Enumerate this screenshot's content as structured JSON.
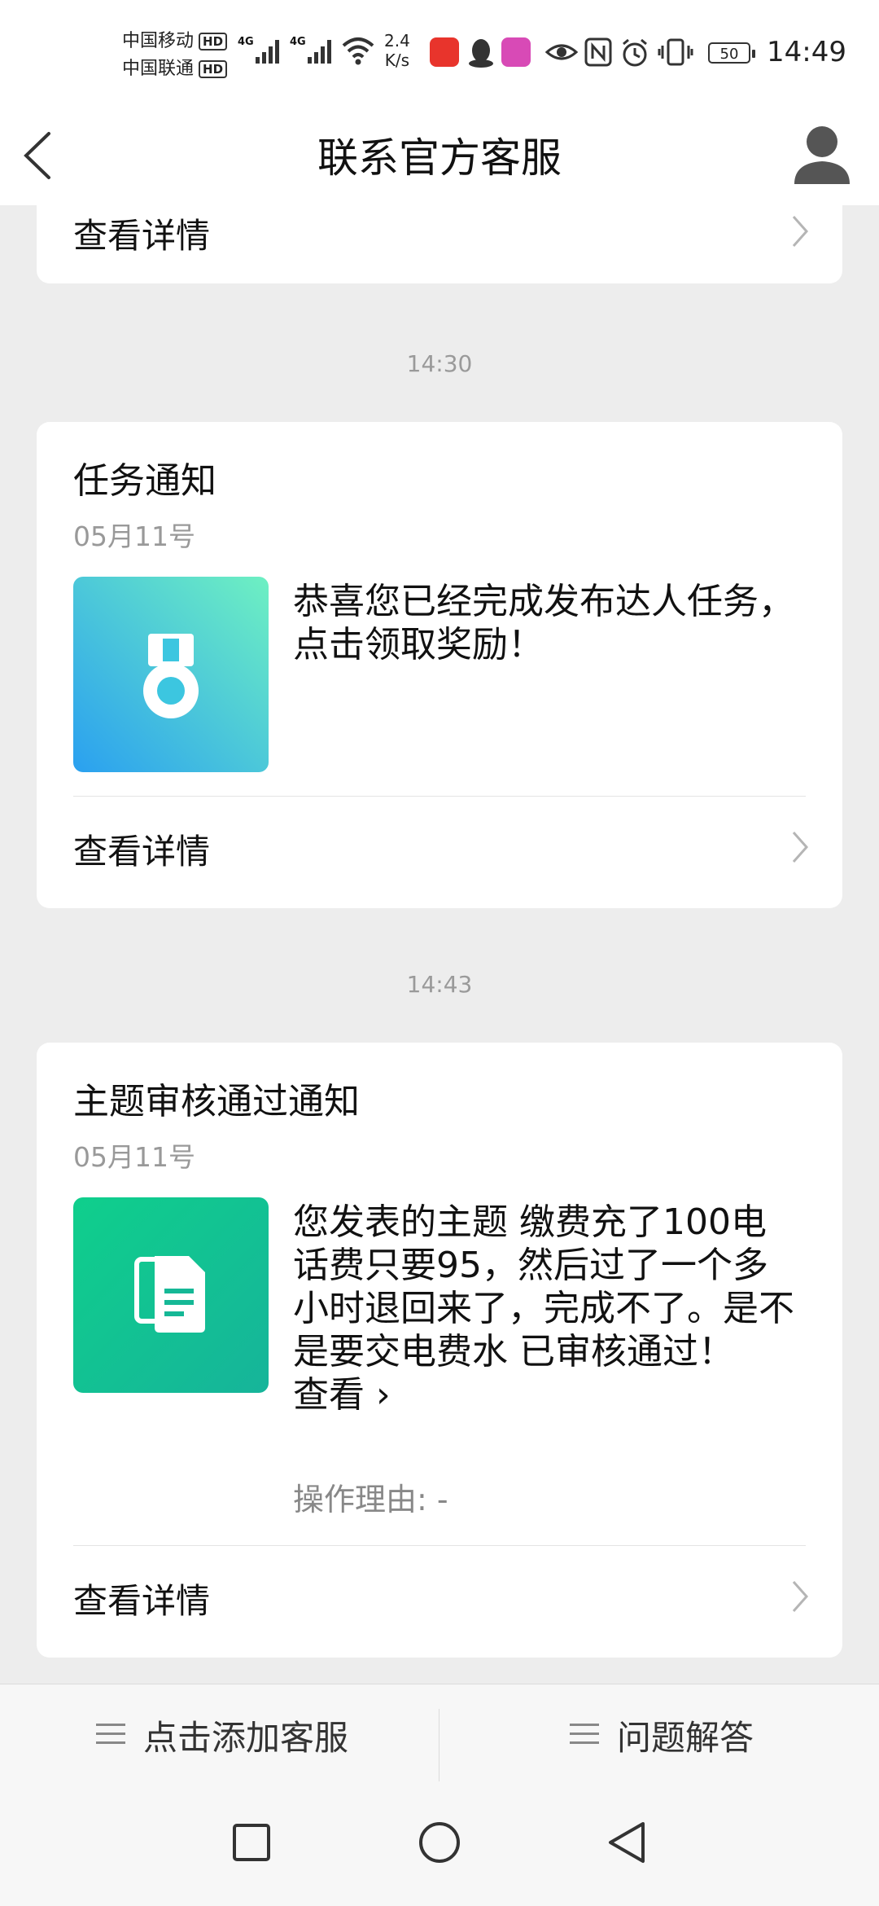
{
  "status_bar": {
    "carrier_1": "中国移动",
    "carrier_2": "中国联通",
    "hd_badge": "HD",
    "network_1": "4G",
    "network_2": "4G",
    "speed_value": "2.4",
    "speed_unit": "K/s",
    "battery": "50",
    "time": "14:49"
  },
  "header": {
    "title": "联系官方客服"
  },
  "feed": {
    "top_detail_label": "查看详情",
    "time_1": "14:30",
    "time_2": "14:43",
    "cards": [
      {
        "title": "任务通知",
        "date": "05月11号",
        "text": "恭喜您已经完成发布达人任务，点击领取奖励！",
        "detail_label": "查看详情"
      },
      {
        "title": "主题审核通过通知",
        "date": "05月11号",
        "text": "您发表的主题 缴费充了100电话费只要95，然后过了一个多小时退回来了，完成不了。是不是要交电费水 已审核通过！",
        "view_link": "查看 ›",
        "reason": "操作理由: -",
        "detail_label": "查看详情"
      }
    ]
  },
  "bottom_menu": {
    "item_1": "点击添加客服",
    "item_2": "问题解答"
  },
  "colors": {
    "task_gradient_start": "#6ef0c2",
    "task_gradient_end": "#2aa0f0",
    "review_gradient_start": "#0fcf8c",
    "review_gradient_end": "#16b49a"
  }
}
